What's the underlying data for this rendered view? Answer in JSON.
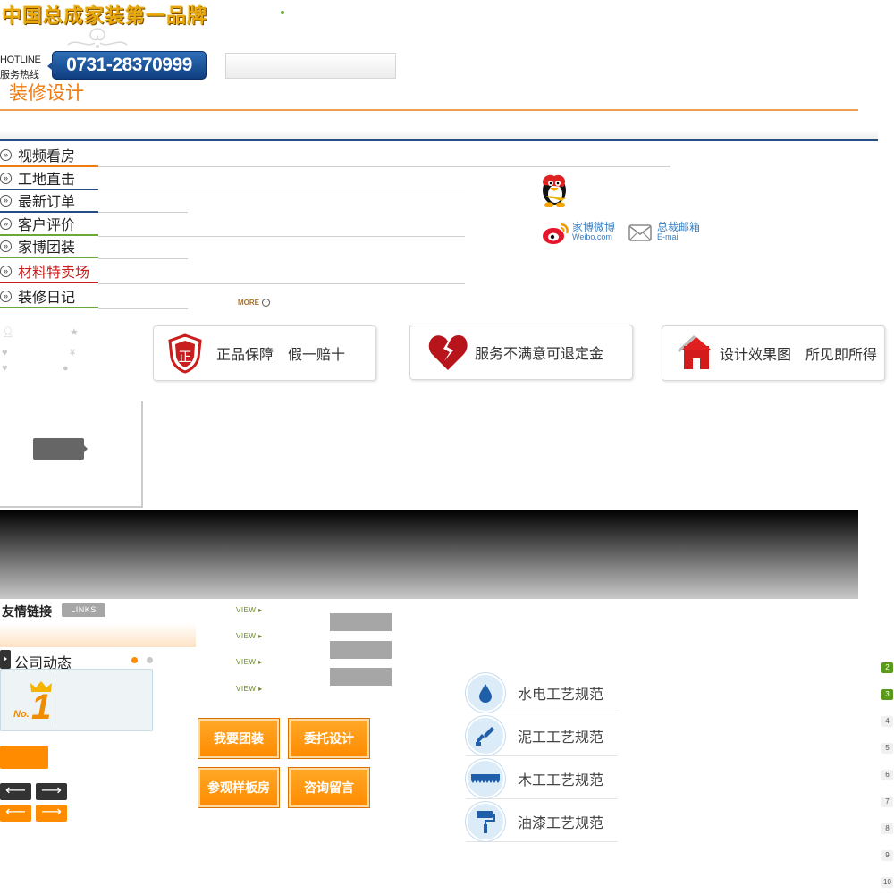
{
  "header": {
    "slogan": "中国总成家装第一品牌",
    "hotline_en": "HOTLINE",
    "hotline_cn": "服务热线",
    "phone": "0731-28370999",
    "search_placeholder": "",
    "section_title": "装修设计"
  },
  "menu": {
    "items": [
      {
        "label": "视频看房"
      },
      {
        "label": "工地直击"
      },
      {
        "label": "最新订单"
      },
      {
        "label": "客户评价"
      },
      {
        "label": "家博团装"
      },
      {
        "label": "材料特卖场"
      },
      {
        "label": "装修日记"
      }
    ],
    "more_label": "MORE"
  },
  "social": {
    "weibo_label": "家博微博",
    "weibo_sub": "Weibo.com",
    "email_label": "总裁邮箱",
    "email_sub": "E-mail"
  },
  "promos": [
    {
      "icon": "shield-zheng-icon",
      "badge": "正",
      "text": "正品保障　假一赔十"
    },
    {
      "icon": "broken-heart-icon",
      "text": "服务不满意可退定金"
    },
    {
      "icon": "house-icon",
      "text": "设计效果图　所见即所得"
    }
  ],
  "links": {
    "title": "友情链接",
    "badge": "LINKS",
    "view_label": "VIEW ▸"
  },
  "news": {
    "title": "公司动态",
    "no1_label": "No.",
    "no1_number": "1"
  },
  "actions": [
    {
      "label": "我要团装"
    },
    {
      "label": "委托设计"
    },
    {
      "label": "参观样板房"
    },
    {
      "label": "咨询留言"
    }
  ],
  "specs": [
    {
      "icon": "water-drop-icon",
      "label": "水电工艺规范"
    },
    {
      "icon": "trowel-icon",
      "label": "泥工工艺规范"
    },
    {
      "icon": "saw-icon",
      "label": "木工工艺规范"
    },
    {
      "icon": "paint-roller-icon",
      "label": "油漆工艺规范"
    }
  ],
  "pager": [
    "2",
    "3",
    "4",
    "5",
    "6",
    "7",
    "8",
    "9",
    "10"
  ],
  "colors": {
    "accent_orange": "#ff8c00",
    "brand_blue": "#234d84",
    "hot_red": "#c81e1e",
    "pager_green": "#5a9a1a"
  }
}
